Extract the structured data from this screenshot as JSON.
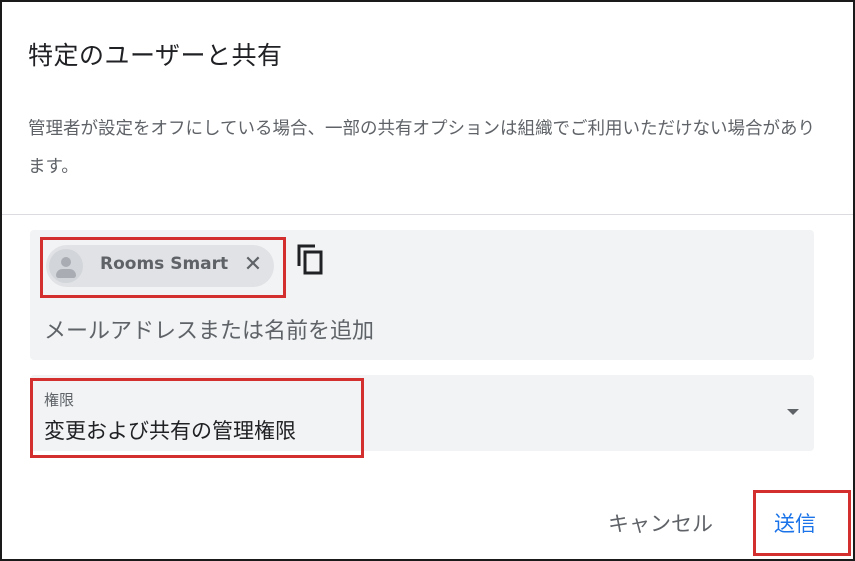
{
  "dialog": {
    "title": "特定のユーザーと共有",
    "notice": "管理者が設定をオフにしている場合、一部の共有オプションは組織でご利用いただけない場合があります。"
  },
  "recipients": {
    "chips": [
      {
        "name": "Rooms Smart",
        "avatar_icon": "person-avatar-icon",
        "remove_symbol": "✕"
      }
    ],
    "copy_icon": "copy-icon",
    "input_placeholder": "メールアドレスまたは名前を追加",
    "input_value": ""
  },
  "permission": {
    "label": "権限",
    "selected": "変更および共有の管理権限",
    "dropdown_icon": "dropdown-arrow-icon"
  },
  "actions": {
    "cancel_label": "キャンセル",
    "send_label": "送信"
  },
  "colors": {
    "accent": "#1a73e8",
    "highlight": "#d32f2f",
    "field_bg": "#f1f3f4",
    "chip_bg": "#e0e2e5"
  }
}
